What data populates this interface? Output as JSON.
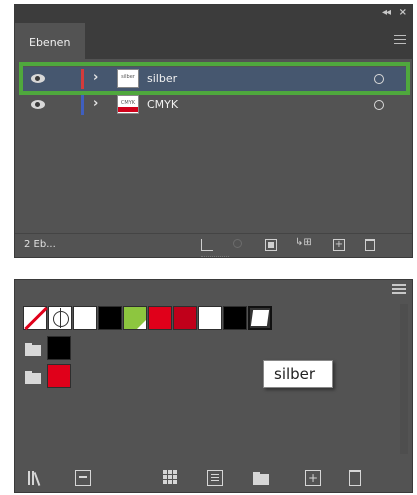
{
  "layers_panel": {
    "collapse_glyph": "◂◂",
    "close_glyph": "×",
    "tab_label": "Ebenen",
    "menu_icon": "hamburger-menu-icon",
    "layers": [
      {
        "name": "silber",
        "color": "#d33b3b",
        "selected": true,
        "thumb_text": "silber"
      },
      {
        "name": "CMYK",
        "color": "#3f5fbf",
        "selected": false,
        "thumb_text": "CMYK"
      }
    ],
    "highlight_color": "#4fa83d",
    "footer": {
      "layer_count": "2 Eb...",
      "sublayer_glyph": "↳⊞",
      "new_layer_glyph": "+"
    }
  },
  "swatches_panel": {
    "swatches": [
      {
        "kind": "none"
      },
      {
        "kind": "registration"
      },
      {
        "kind": "color",
        "color": "#ffffff"
      },
      {
        "kind": "color",
        "color": "#000000"
      },
      {
        "kind": "color-global",
        "color": "#8dc63f"
      },
      {
        "kind": "color",
        "color": "#e0001a"
      },
      {
        "kind": "color",
        "color": "#c0001a"
      },
      {
        "kind": "color",
        "color": "#ffffff"
      },
      {
        "kind": "color",
        "color": "#000000"
      },
      {
        "kind": "last-used",
        "color": "#ffffff"
      }
    ],
    "groups": [
      {
        "icon": "folder-icon",
        "color": "#000000"
      },
      {
        "icon": "folder-icon",
        "color": "#e0001a"
      }
    ],
    "tooltip": "silber",
    "new_swatch_glyph": "+"
  }
}
